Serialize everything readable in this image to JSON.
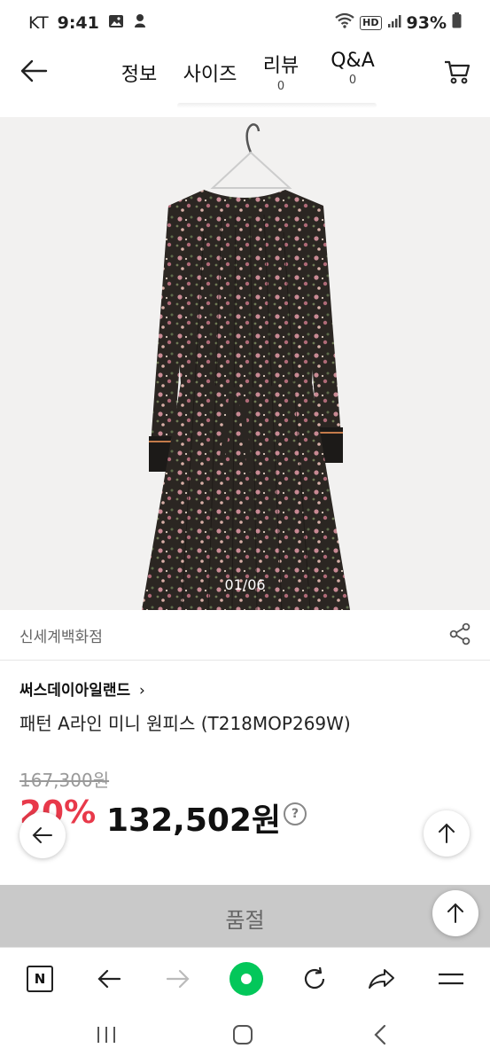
{
  "status_bar": {
    "carrier": "KT",
    "time": "9:41",
    "hd_badge": "HD",
    "battery": "93%"
  },
  "nav": {
    "tabs": [
      {
        "label": "정보",
        "count": ""
      },
      {
        "label": "사이즈",
        "count": ""
      },
      {
        "label": "리뷰",
        "count": "0"
      },
      {
        "label": "Q&A",
        "count": "0"
      }
    ]
  },
  "gallery": {
    "counter": "01/06",
    "colors": {
      "background": "#f2f1f0",
      "dress": "#2b2622",
      "print_pink": "#c98a94",
      "print_green": "#5d6b4a"
    }
  },
  "seller": {
    "name": "신세계백화점"
  },
  "product": {
    "brand": "써스데이아일랜드",
    "title": "패턴 A라인 미니 원피스 (T218MOP269W)",
    "original_price": "167,300원",
    "discount_rate": "20%",
    "sale_price": "132,502원",
    "help_mark": "?"
  },
  "sold_out": {
    "label": "품절"
  },
  "browser": {
    "home_badge": "N"
  },
  "colors": {
    "accent": "#e8394a",
    "naver_green": "#03c75a"
  }
}
